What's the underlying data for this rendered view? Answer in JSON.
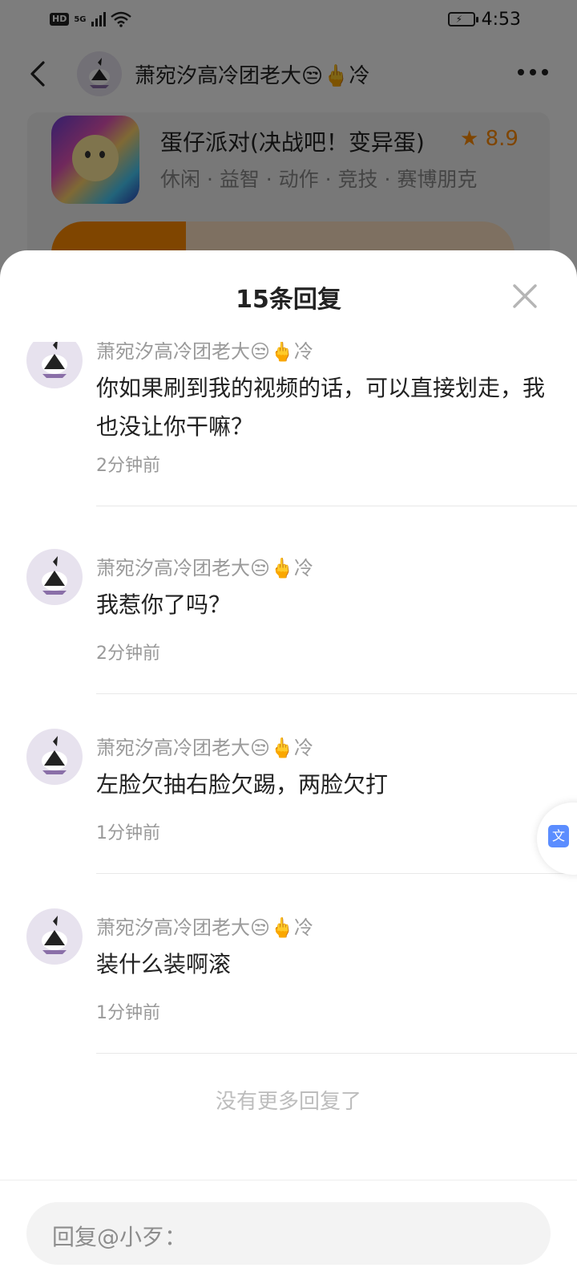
{
  "status_bar": {
    "hd": "HD",
    "network": "5G",
    "time": "4:53"
  },
  "nav": {
    "title": "萧宛汐高冷团老大😒🖕冷"
  },
  "game": {
    "title": "蛋仔派对(决战吧！变异蛋)",
    "rating": "★ 8.9",
    "tags": "休闲 · 益智 · 动作 · 竞技 · 赛博朋克"
  },
  "sheet": {
    "title": "15条回复",
    "replies": [
      {
        "name": "萧宛汐高冷团老大😒🖕冷",
        "text": "你如果刷到我的视频的话，可以直接划走，我也没让你干嘛？",
        "time": "2分钟前"
      },
      {
        "name": "萧宛汐高冷团老大😒🖕冷",
        "text": "我惹你了吗？",
        "time": "2分钟前"
      },
      {
        "name": "萧宛汐高冷团老大😒🖕冷",
        "text": "左脸欠抽右脸欠踢，两脸欠打",
        "time": "1分钟前"
      },
      {
        "name": "萧宛汐高冷团老大😒🖕冷",
        "text": "装什么装啊滚",
        "time": "1分钟前"
      }
    ],
    "no_more": "没有更多回复了",
    "input_placeholder": "回复@小歹："
  },
  "colors": {
    "accent": "#ff8a00",
    "overlay": "rgba(0,0,0,0.5)",
    "muted": "#9a9a9a"
  }
}
